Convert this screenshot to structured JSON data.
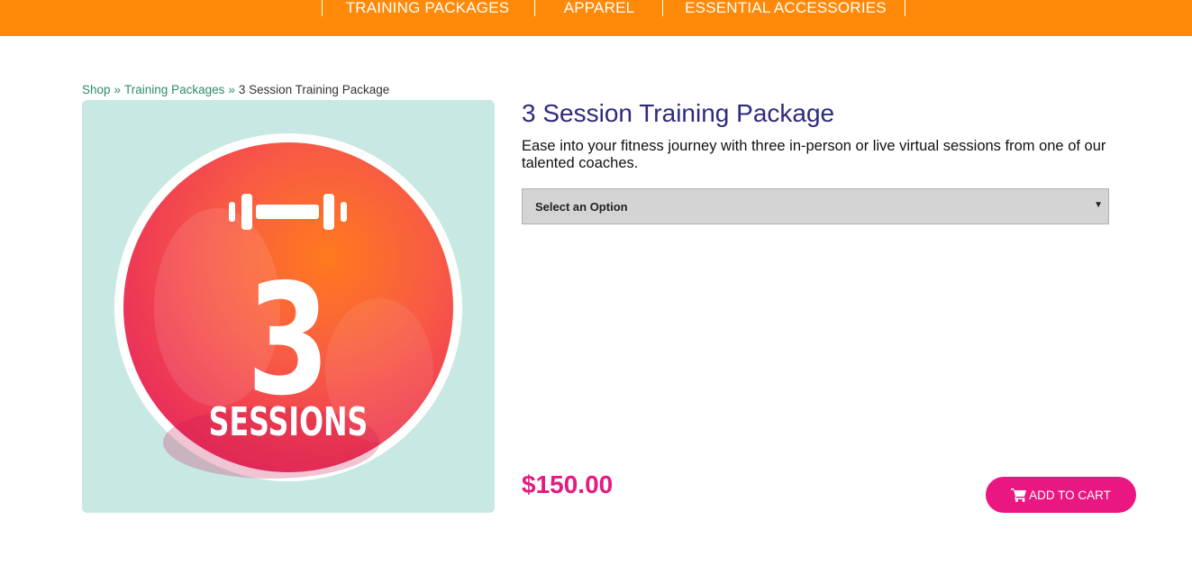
{
  "nav": {
    "items": [
      {
        "label": "TRAINING PACKAGES"
      },
      {
        "label": "APPAREL"
      },
      {
        "label": "ESSENTIAL ACCESSORIES"
      }
    ]
  },
  "breadcrumb": {
    "items": [
      "Shop",
      "Training Packages",
      "3 Session Training Package"
    ],
    "separator": "»"
  },
  "product": {
    "title": "3 Session Training Package",
    "description": "Ease into your fitness journey with three in-person or live virtual sessions from one of our talented coaches.",
    "image": {
      "number": "3",
      "label": "SESSIONS",
      "icon": "dumbbell-icon"
    },
    "option_select": {
      "selected": "Select an Option"
    },
    "price": "$150.00",
    "add_to_cart_label": "ADD TO CART"
  },
  "colors": {
    "nav_bg": "#ff8a0a",
    "title": "#2d2b7c",
    "price": "#e31b82",
    "button": "#ea1682",
    "breadcrumb_link": "#2e8b66",
    "image_bg": "#c8e8e3"
  }
}
